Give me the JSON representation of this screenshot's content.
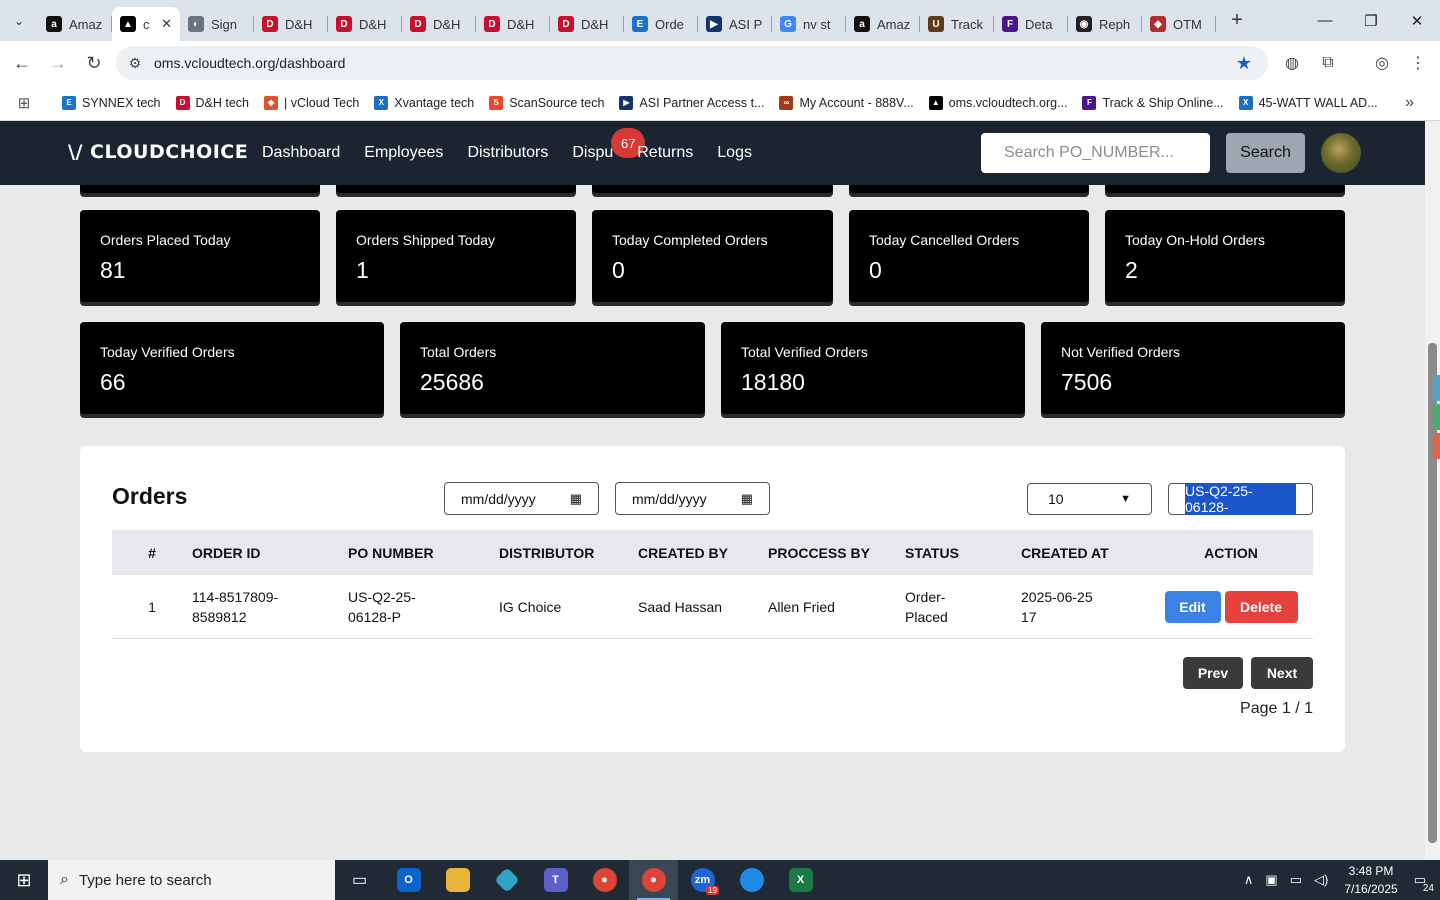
{
  "browser": {
    "tabs": [
      {
        "label": "Amaz",
        "fav_color": "#111111",
        "fav_glyph": "a"
      },
      {
        "label": "c",
        "fav_color": "#000000",
        "fav_glyph": "▲",
        "active": true
      },
      {
        "label": "Sign",
        "fav_color": "#6b7480",
        "fav_glyph": "◐"
      },
      {
        "label": "D&H",
        "fav_color": "#c8102e",
        "fav_glyph": "D"
      },
      {
        "label": "D&H",
        "fav_color": "#c8102e",
        "fav_glyph": "D"
      },
      {
        "label": "D&H",
        "fav_color": "#c8102e",
        "fav_glyph": "D"
      },
      {
        "label": "D&H",
        "fav_color": "#c8102e",
        "fav_glyph": "D"
      },
      {
        "label": "D&H",
        "fav_color": "#c8102e",
        "fav_glyph": "D"
      },
      {
        "label": "Orde",
        "fav_color": "#1a73c9",
        "fav_glyph": "E"
      },
      {
        "label": "ASI P",
        "fav_color": "#14336b",
        "fav_glyph": "▶"
      },
      {
        "label": "nv st",
        "fav_color": "#4285f4",
        "fav_glyph": "G"
      },
      {
        "label": "Amaz",
        "fav_color": "#111111",
        "fav_glyph": "a"
      },
      {
        "label": "Track",
        "fav_color": "#5b3a1a",
        "fav_glyph": "U"
      },
      {
        "label": "Deta",
        "fav_color": "#4d148c",
        "fav_glyph": "F"
      },
      {
        "label": "Reph",
        "fav_color": "#222222",
        "fav_glyph": "◉"
      },
      {
        "label": "OTM",
        "fav_color": "#b52b2b",
        "fav_glyph": "◆"
      }
    ],
    "close_glyph": "✕",
    "new_tab_glyph": "+",
    "url": "oms.vcloudtech.org/dashboard",
    "bookmarks": [
      {
        "label": "SYNNEX tech",
        "color": "#1a73c9",
        "glyph": "E"
      },
      {
        "label": "D&H tech",
        "color": "#c8102e",
        "glyph": "D"
      },
      {
        "label": "| vCloud Tech",
        "color": "#d9532c",
        "glyph": "◆"
      },
      {
        "label": "Xvantage tech",
        "color": "#1a6fc0",
        "glyph": "X"
      },
      {
        "label": "ScanSource tech",
        "color": "#e24a2a",
        "glyph": "S"
      },
      {
        "label": "ASI Partner Access t...",
        "color": "#14336b",
        "glyph": "▶"
      },
      {
        "label": "My Account - 888V...",
        "color": "#a23a1a",
        "glyph": "∞"
      },
      {
        "label": "oms.vcloudtech.org...",
        "color": "#000000",
        "glyph": "▲"
      },
      {
        "label": "Track & Ship Online...",
        "color": "#4d148c",
        "glyph": "F"
      },
      {
        "label": "45-WATT WALL AD...",
        "color": "#1a6fc0",
        "glyph": "X"
      }
    ]
  },
  "app": {
    "logo": "\\/ CLOUDCHOICE",
    "nav": [
      "Dashboard",
      "Employees",
      "Distributors",
      "Dispu",
      "Returns",
      "Logs"
    ],
    "disputes_badge": "67",
    "search_placeholder": "Search PO_NUMBER...",
    "search_button": "Search"
  },
  "stats_row1": [
    {
      "label": "Orders Placed Today",
      "value": "81"
    },
    {
      "label": "Orders Shipped Today",
      "value": "1"
    },
    {
      "label": "Today Completed Orders",
      "value": "0"
    },
    {
      "label": "Today Cancelled Orders",
      "value": "0"
    },
    {
      "label": "Today On-Hold Orders",
      "value": "2"
    }
  ],
  "stats_row2": [
    {
      "label": "Today Verified Orders",
      "value": "66"
    },
    {
      "label": "Total Orders",
      "value": "25686"
    },
    {
      "label": "Total Verified Orders",
      "value": "18180"
    },
    {
      "label": "Not Verified Orders",
      "value": "7506"
    }
  ],
  "orders": {
    "title": "Orders",
    "date_from_placeholder": "mm/dd/yyyy",
    "date_to_placeholder": "mm/dd/yyyy",
    "per_page": "10",
    "filter_value": "US-Q2-25-06128-",
    "columns": [
      "#",
      "ORDER ID",
      "PO NUMBER",
      "DISTRIBUTOR",
      "CREATED BY",
      "PROCCESS BY",
      "STATUS",
      "CREATED AT",
      "ACTION"
    ],
    "rows": [
      {
        "index": "1",
        "order_id": "114-8517809-8589812",
        "po_number": "US-Q2-25-06128-P",
        "distributor": "IG Choice",
        "created_by": "Saad Hassan",
        "process_by": "Allen Fried",
        "status": "Order-Placed",
        "created_at": "2025-06-25 17"
      }
    ],
    "edit_label": "Edit",
    "delete_label": "Delete",
    "prev_label": "Prev",
    "next_label": "Next",
    "page_info": "Page 1 / 1"
  },
  "taskbar": {
    "search_placeholder": "Type here to search",
    "time": "3:48 PM",
    "date": "7/16/2025",
    "notifications": "24",
    "zoom_badge": "19"
  }
}
